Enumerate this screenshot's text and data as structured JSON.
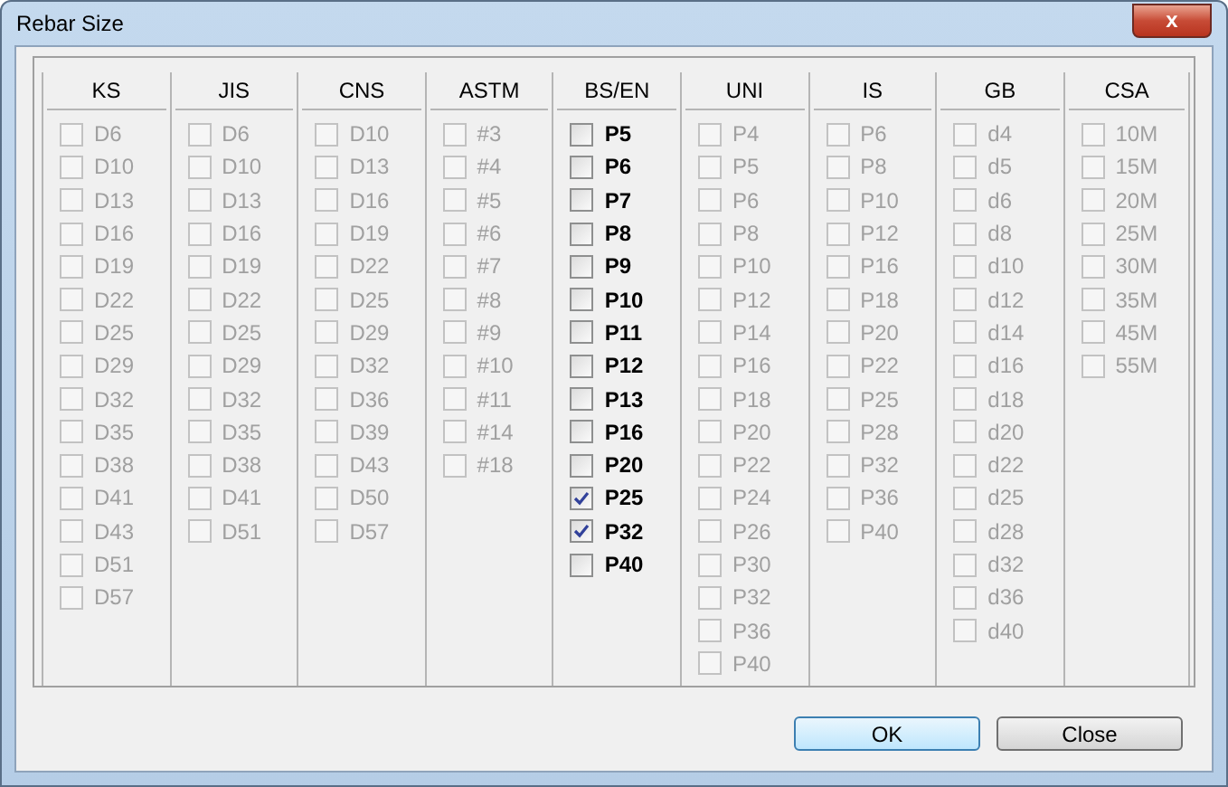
{
  "window": {
    "title": "Rebar Size",
    "close": "x"
  },
  "columns": [
    {
      "header": "KS",
      "disabled": true,
      "items": [
        {
          "label": "D6",
          "checked": false
        },
        {
          "label": "D10",
          "checked": false
        },
        {
          "label": "D13",
          "checked": false
        },
        {
          "label": "D16",
          "checked": false
        },
        {
          "label": "D19",
          "checked": false
        },
        {
          "label": "D22",
          "checked": false
        },
        {
          "label": "D25",
          "checked": false
        },
        {
          "label": "D29",
          "checked": false
        },
        {
          "label": "D32",
          "checked": false
        },
        {
          "label": "D35",
          "checked": false
        },
        {
          "label": "D38",
          "checked": false
        },
        {
          "label": "D41",
          "checked": false
        },
        {
          "label": "D43",
          "checked": false
        },
        {
          "label": "D51",
          "checked": false
        },
        {
          "label": "D57",
          "checked": false
        }
      ]
    },
    {
      "header": "JIS",
      "disabled": true,
      "items": [
        {
          "label": "D6",
          "checked": false
        },
        {
          "label": "D10",
          "checked": false
        },
        {
          "label": "D13",
          "checked": false
        },
        {
          "label": "D16",
          "checked": false
        },
        {
          "label": "D19",
          "checked": false
        },
        {
          "label": "D22",
          "checked": false
        },
        {
          "label": "D25",
          "checked": false
        },
        {
          "label": "D29",
          "checked": false
        },
        {
          "label": "D32",
          "checked": false
        },
        {
          "label": "D35",
          "checked": false
        },
        {
          "label": "D38",
          "checked": false
        },
        {
          "label": "D41",
          "checked": false
        },
        {
          "label": "D51",
          "checked": false
        }
      ]
    },
    {
      "header": "CNS",
      "disabled": true,
      "items": [
        {
          "label": "D10",
          "checked": false
        },
        {
          "label": "D13",
          "checked": false
        },
        {
          "label": "D16",
          "checked": false
        },
        {
          "label": "D19",
          "checked": false
        },
        {
          "label": "D22",
          "checked": false
        },
        {
          "label": "D25",
          "checked": false
        },
        {
          "label": "D29",
          "checked": false
        },
        {
          "label": "D32",
          "checked": false
        },
        {
          "label": "D36",
          "checked": false
        },
        {
          "label": "D39",
          "checked": false
        },
        {
          "label": "D43",
          "checked": false
        },
        {
          "label": "D50",
          "checked": false
        },
        {
          "label": "D57",
          "checked": false
        }
      ]
    },
    {
      "header": "ASTM",
      "disabled": true,
      "items": [
        {
          "label": "#3",
          "checked": false
        },
        {
          "label": "#4",
          "checked": false
        },
        {
          "label": "#5",
          "checked": false
        },
        {
          "label": "#6",
          "checked": false
        },
        {
          "label": "#7",
          "checked": false
        },
        {
          "label": "#8",
          "checked": false
        },
        {
          "label": "#9",
          "checked": false
        },
        {
          "label": "#10",
          "checked": false
        },
        {
          "label": "#11",
          "checked": false
        },
        {
          "label": "#14",
          "checked": false
        },
        {
          "label": "#18",
          "checked": false
        }
      ]
    },
    {
      "header": "BS/EN",
      "disabled": false,
      "items": [
        {
          "label": "P5",
          "checked": false
        },
        {
          "label": "P6",
          "checked": false
        },
        {
          "label": "P7",
          "checked": false
        },
        {
          "label": "P8",
          "checked": false
        },
        {
          "label": "P9",
          "checked": false
        },
        {
          "label": "P10",
          "checked": false
        },
        {
          "label": "P11",
          "checked": false
        },
        {
          "label": "P12",
          "checked": false
        },
        {
          "label": "P13",
          "checked": false
        },
        {
          "label": "P16",
          "checked": false
        },
        {
          "label": "P20",
          "checked": false
        },
        {
          "label": "P25",
          "checked": true
        },
        {
          "label": "P32",
          "checked": true
        },
        {
          "label": "P40",
          "checked": false
        }
      ]
    },
    {
      "header": "UNI",
      "disabled": true,
      "items": [
        {
          "label": "P4",
          "checked": false
        },
        {
          "label": "P5",
          "checked": false
        },
        {
          "label": "P6",
          "checked": false
        },
        {
          "label": "P8",
          "checked": false
        },
        {
          "label": "P10",
          "checked": false
        },
        {
          "label": "P12",
          "checked": false
        },
        {
          "label": "P14",
          "checked": false
        },
        {
          "label": "P16",
          "checked": false
        },
        {
          "label": "P18",
          "checked": false
        },
        {
          "label": "P20",
          "checked": false
        },
        {
          "label": "P22",
          "checked": false
        },
        {
          "label": "P24",
          "checked": false
        },
        {
          "label": "P26",
          "checked": false
        },
        {
          "label": "P30",
          "checked": false
        },
        {
          "label": "P32",
          "checked": false
        },
        {
          "label": "P36",
          "checked": false
        },
        {
          "label": "P40",
          "checked": false
        }
      ]
    },
    {
      "header": "IS",
      "disabled": true,
      "items": [
        {
          "label": "P6",
          "checked": false
        },
        {
          "label": "P8",
          "checked": false
        },
        {
          "label": "P10",
          "checked": false
        },
        {
          "label": "P12",
          "checked": false
        },
        {
          "label": "P16",
          "checked": false
        },
        {
          "label": "P18",
          "checked": false
        },
        {
          "label": "P20",
          "checked": false
        },
        {
          "label": "P22",
          "checked": false
        },
        {
          "label": "P25",
          "checked": false
        },
        {
          "label": "P28",
          "checked": false
        },
        {
          "label": "P32",
          "checked": false
        },
        {
          "label": "P36",
          "checked": false
        },
        {
          "label": "P40",
          "checked": false
        }
      ]
    },
    {
      "header": "GB",
      "disabled": true,
      "items": [
        {
          "label": "d4",
          "checked": false
        },
        {
          "label": "d5",
          "checked": false
        },
        {
          "label": "d6",
          "checked": false
        },
        {
          "label": "d8",
          "checked": false
        },
        {
          "label": "d10",
          "checked": false
        },
        {
          "label": "d12",
          "checked": false
        },
        {
          "label": "d14",
          "checked": false
        },
        {
          "label": "d16",
          "checked": false
        },
        {
          "label": "d18",
          "checked": false
        },
        {
          "label": "d20",
          "checked": false
        },
        {
          "label": "d22",
          "checked": false
        },
        {
          "label": "d25",
          "checked": false
        },
        {
          "label": "d28",
          "checked": false
        },
        {
          "label": "d32",
          "checked": false
        },
        {
          "label": "d36",
          "checked": false
        },
        {
          "label": "d40",
          "checked": false
        }
      ]
    },
    {
      "header": "CSA",
      "disabled": true,
      "items": [
        {
          "label": "10M",
          "checked": false
        },
        {
          "label": "15M",
          "checked": false
        },
        {
          "label": "20M",
          "checked": false
        },
        {
          "label": "25M",
          "checked": false
        },
        {
          "label": "30M",
          "checked": false
        },
        {
          "label": "35M",
          "checked": false
        },
        {
          "label": "45M",
          "checked": false
        },
        {
          "label": "55M",
          "checked": false
        }
      ]
    }
  ],
  "buttons": [
    {
      "label": "OK",
      "default": true
    },
    {
      "label": "Close",
      "default": false
    }
  ]
}
